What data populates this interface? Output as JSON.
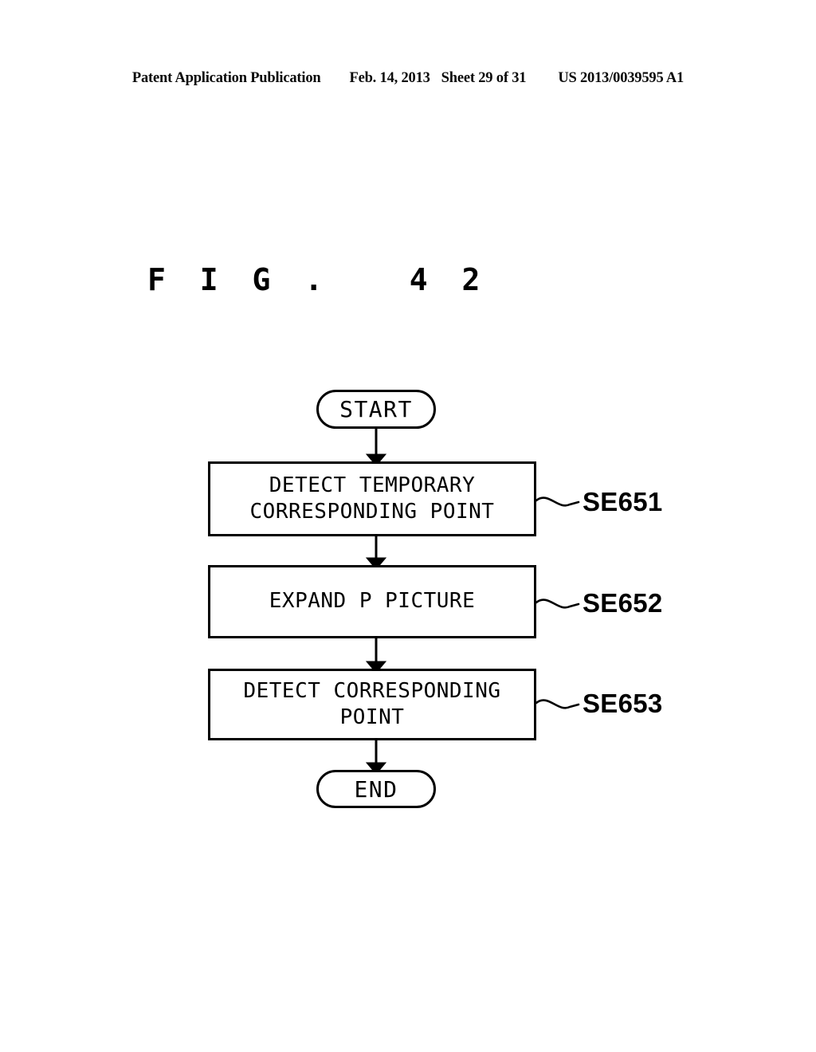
{
  "header": {
    "publication": "Patent Application Publication",
    "date": "Feb. 14, 2013",
    "sheet": "Sheet 29 of 31",
    "docnum": "US 2013/0039595 A1"
  },
  "figure": {
    "title": "F I G .   4 2"
  },
  "flowchart": {
    "nodes": [
      {
        "id": "start",
        "shape": "terminal",
        "text": "START"
      },
      {
        "id": "se651",
        "shape": "process",
        "text": "DETECT TEMPORARY\nCORRESPONDING POINT"
      },
      {
        "id": "se652",
        "shape": "process",
        "text": "EXPAND P PICTURE"
      },
      {
        "id": "se653",
        "shape": "process",
        "text": "DETECT CORRESPONDING POINT"
      },
      {
        "id": "end",
        "shape": "terminal",
        "text": "END"
      }
    ],
    "step_labels": [
      {
        "id": "se651",
        "text": "SE651"
      },
      {
        "id": "se652",
        "text": "SE652"
      },
      {
        "id": "se653",
        "text": "SE653"
      }
    ],
    "connectors": [
      {
        "from": "start",
        "to": "se651",
        "arrow": true
      },
      {
        "from": "se651",
        "to": "se652",
        "arrow": true
      },
      {
        "from": "se652",
        "to": "se653",
        "arrow": true
      },
      {
        "from": "se653",
        "to": "end",
        "arrow": true
      }
    ]
  },
  "colors": {
    "ink": "#000000",
    "paper": "#ffffff"
  }
}
